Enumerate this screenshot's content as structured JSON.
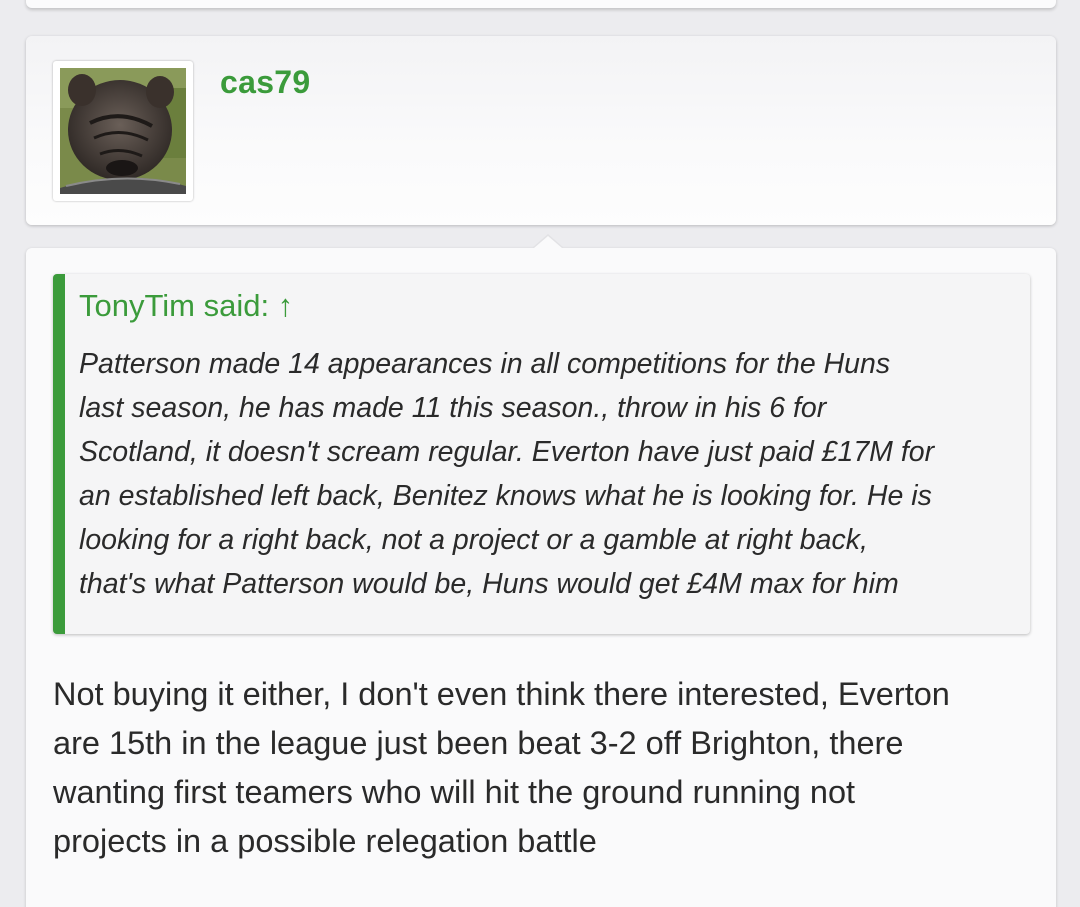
{
  "post": {
    "author": "cas79",
    "quote": {
      "author": "TonyTim",
      "said_label": "said:",
      "jump_arrow": "↑",
      "lines": [
        "Patterson made 14 appearances in all competitions for the Huns",
        "last season, he has made 11 this season., throw in his 6 for",
        "Scotland, it doesn't scream regular. Everton have just paid £17M for",
        "an established left back, Benitez knows what he is looking for. He is",
        "looking for a right back, not a project or a gamble at right back,",
        "that's what Patterson would be, Huns would get £4M max for him"
      ]
    },
    "reply_lines": [
      "Not buying it either, I don't even think there interested, Everton",
      "are 15th in the league just been beat 3-2 off Brighton, there",
      "wanting first teamers who will hit the ground running not",
      "projects in a possible relegation battle"
    ]
  },
  "colors": {
    "accent": "#3b9b3b",
    "text": "#2a2a2a",
    "background": "#ececef"
  }
}
